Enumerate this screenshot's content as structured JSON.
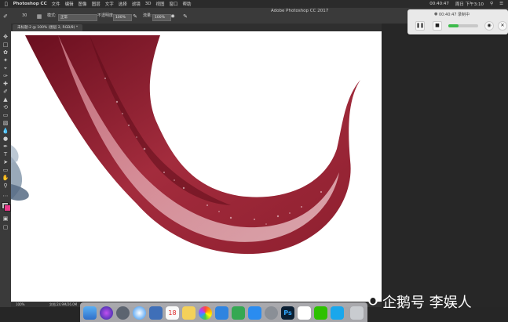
{
  "menubar": {
    "apple": "",
    "app_name": "Photoshop CC",
    "items": [
      "文件",
      "编辑",
      "图像",
      "图层",
      "文字",
      "选择",
      "滤镜",
      "3D",
      "视图",
      "窗口",
      "帮助"
    ],
    "clock": "00:40:47",
    "date": "周日 下午3:10"
  },
  "window_title": "Adobe Photoshop CC 2017",
  "options_bar": {
    "brush_size": "30",
    "mode_label": "模式:",
    "mode_value": "正常",
    "opacity_label": "不透明度:",
    "opacity_value": "100%",
    "flow_label": "流量:",
    "flow_value": "100%"
  },
  "tab": {
    "label": "未标题-2 @ 100% (图层 2, RGB/8) *"
  },
  "statusbar": {
    "zoom": "100%",
    "doc_info": "文档:24.9M/26.0M"
  },
  "recorder": {
    "time": "00:40:47 录制中",
    "stop_icon": "stop-icon",
    "pause_icon": "pause-icon",
    "progress": 0.35
  },
  "watermark": {
    "text": "企鹅号 李娱人"
  },
  "colors": {
    "tentacle_dark": "#7a1424",
    "tentacle_mid": "#b23a4a",
    "tentacle_light": "#e8b2b8",
    "accent_green": "#3dbb4c"
  },
  "dock": {
    "icons": [
      "finder-icon",
      "siri-icon",
      "launchpad-icon",
      "safari-icon",
      "photos-icon",
      "calendar-icon",
      "notes-icon",
      "photos-app-icon",
      "keynote-icon",
      "numbers-icon",
      "appstore-icon",
      "settings-icon",
      "photoshop-icon",
      "baidu-icon",
      "wechat-icon",
      "qq-icon",
      "trash-icon"
    ],
    "photoshop_label": "Ps"
  }
}
